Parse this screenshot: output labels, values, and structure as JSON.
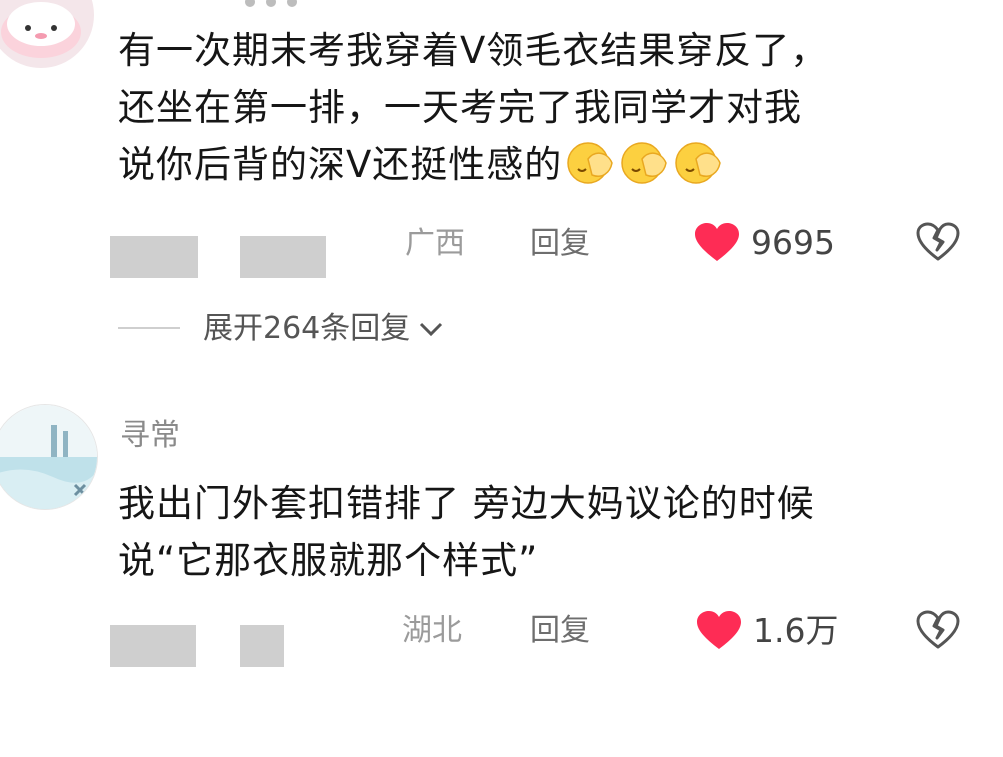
{
  "comments": [
    {
      "text_lines": [
        "有一次期末考我穿着V领毛衣结果穿反了，",
        "还坐在第一排，一天考完了我同学才对我",
        "说你后背的深V还挺性感的"
      ],
      "emoji": "face-palm-emoji",
      "location": "广西",
      "reply_label": "回复",
      "like_count": "9695",
      "expand_label": "展开264条回复"
    },
    {
      "username": "寻常",
      "text_lines": [
        "我出门外套扣错排了 旁边大妈议论的时候",
        "说“它那衣服就那个样式”"
      ],
      "location": "湖北",
      "reply_label": "回复",
      "like_count": "1.6万"
    }
  ],
  "colors": {
    "like": "#fe2c55",
    "meta": "#9b9b9b",
    "text": "#161616"
  },
  "icons": [
    "heart-icon",
    "broken-heart-icon",
    "chevron-down-icon"
  ]
}
